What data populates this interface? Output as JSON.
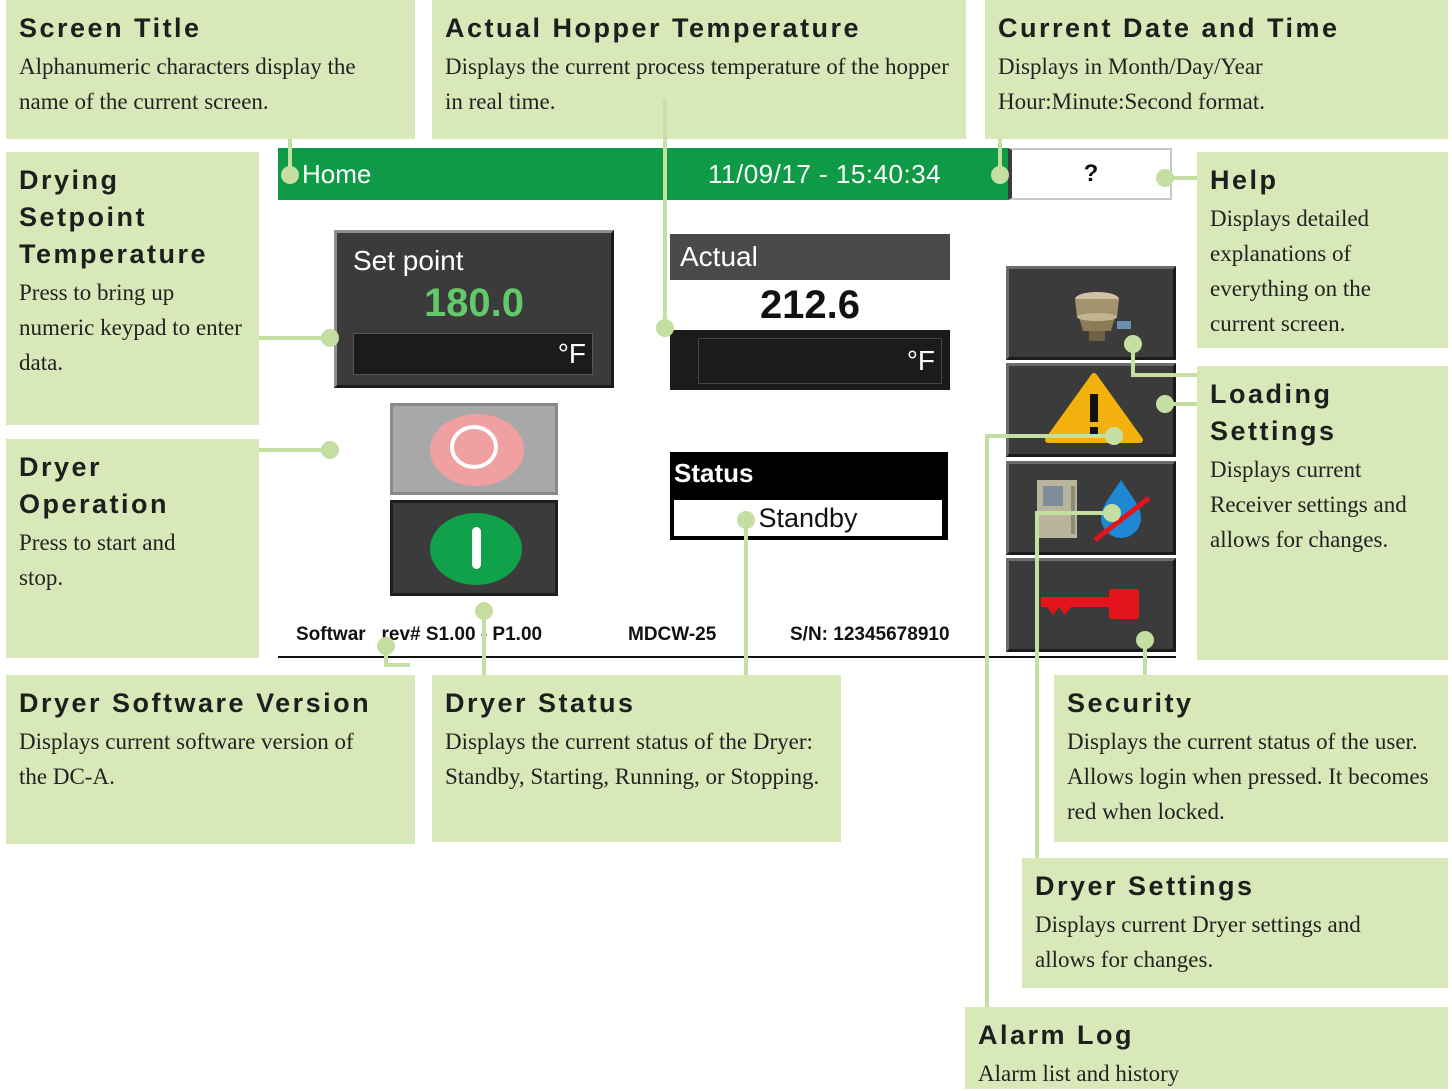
{
  "screen": {
    "title": "Home",
    "datetime": "11/09/17 - 15:40:34",
    "help_label": "?",
    "setpoint": {
      "label": "Set point",
      "value": "180.0",
      "unit": "°F"
    },
    "actual": {
      "label": "Actual",
      "value": "212.6",
      "unit": "°F"
    },
    "status": {
      "label": "Status",
      "value": "Standby"
    },
    "footer": {
      "software": "Softwar   rev# S1.00 - P1.00",
      "model": "MDCW-25",
      "serial": "S/N: 12345678910"
    },
    "side_buttons": [
      "loading-settings",
      "alarm-log",
      "dryer-settings",
      "security"
    ],
    "colors": {
      "title_bar": "#0f9a47",
      "setpoint_value": "#63c96a",
      "callout_bg": "#d9e8b8",
      "leader_line": "#c5dea1"
    }
  },
  "callouts": {
    "screen_title": {
      "heading": "Screen Title",
      "text": "Alphanumeric characters display the name of the current screen."
    },
    "actual_temp": {
      "heading": "Actual Hopper Temperature",
      "text": "Displays the current process temperature of the hopper in real time."
    },
    "date_time": {
      "heading": "Current Date and Time",
      "text": "Displays in Month/Day/Year Hour:Minute:Second format."
    },
    "setpoint_temp": {
      "heading": "Drying Setpoint Temperature",
      "text": "Press to bring up numeric keypad to enter data."
    },
    "help": {
      "heading": "Help",
      "text": "Displays detailed explanations of everything on the current screen."
    },
    "dryer_operation": {
      "heading": "Dryer Operation",
      "text": "Press to start and stop."
    },
    "loading_settings": {
      "heading": "Loading Settings",
      "text": "Displays current Receiver settings and allows for changes."
    },
    "software_version": {
      "heading": "Dryer Software Version",
      "text": "Displays current software version of the DC-A."
    },
    "dryer_status": {
      "heading": "Dryer Status",
      "text": "Displays the current status of the Dryer: Standby, Starting, Running, or Stopping."
    },
    "security": {
      "heading": "Security",
      "text": "Displays the current status of the user. Allows login when pressed. It becomes red when locked."
    },
    "dryer_settings": {
      "heading": "Dryer Settings",
      "text": "Displays current Dryer settings and allows for changes."
    },
    "alarm_log": {
      "heading": "Alarm Log",
      "text": "Alarm list and history"
    }
  }
}
